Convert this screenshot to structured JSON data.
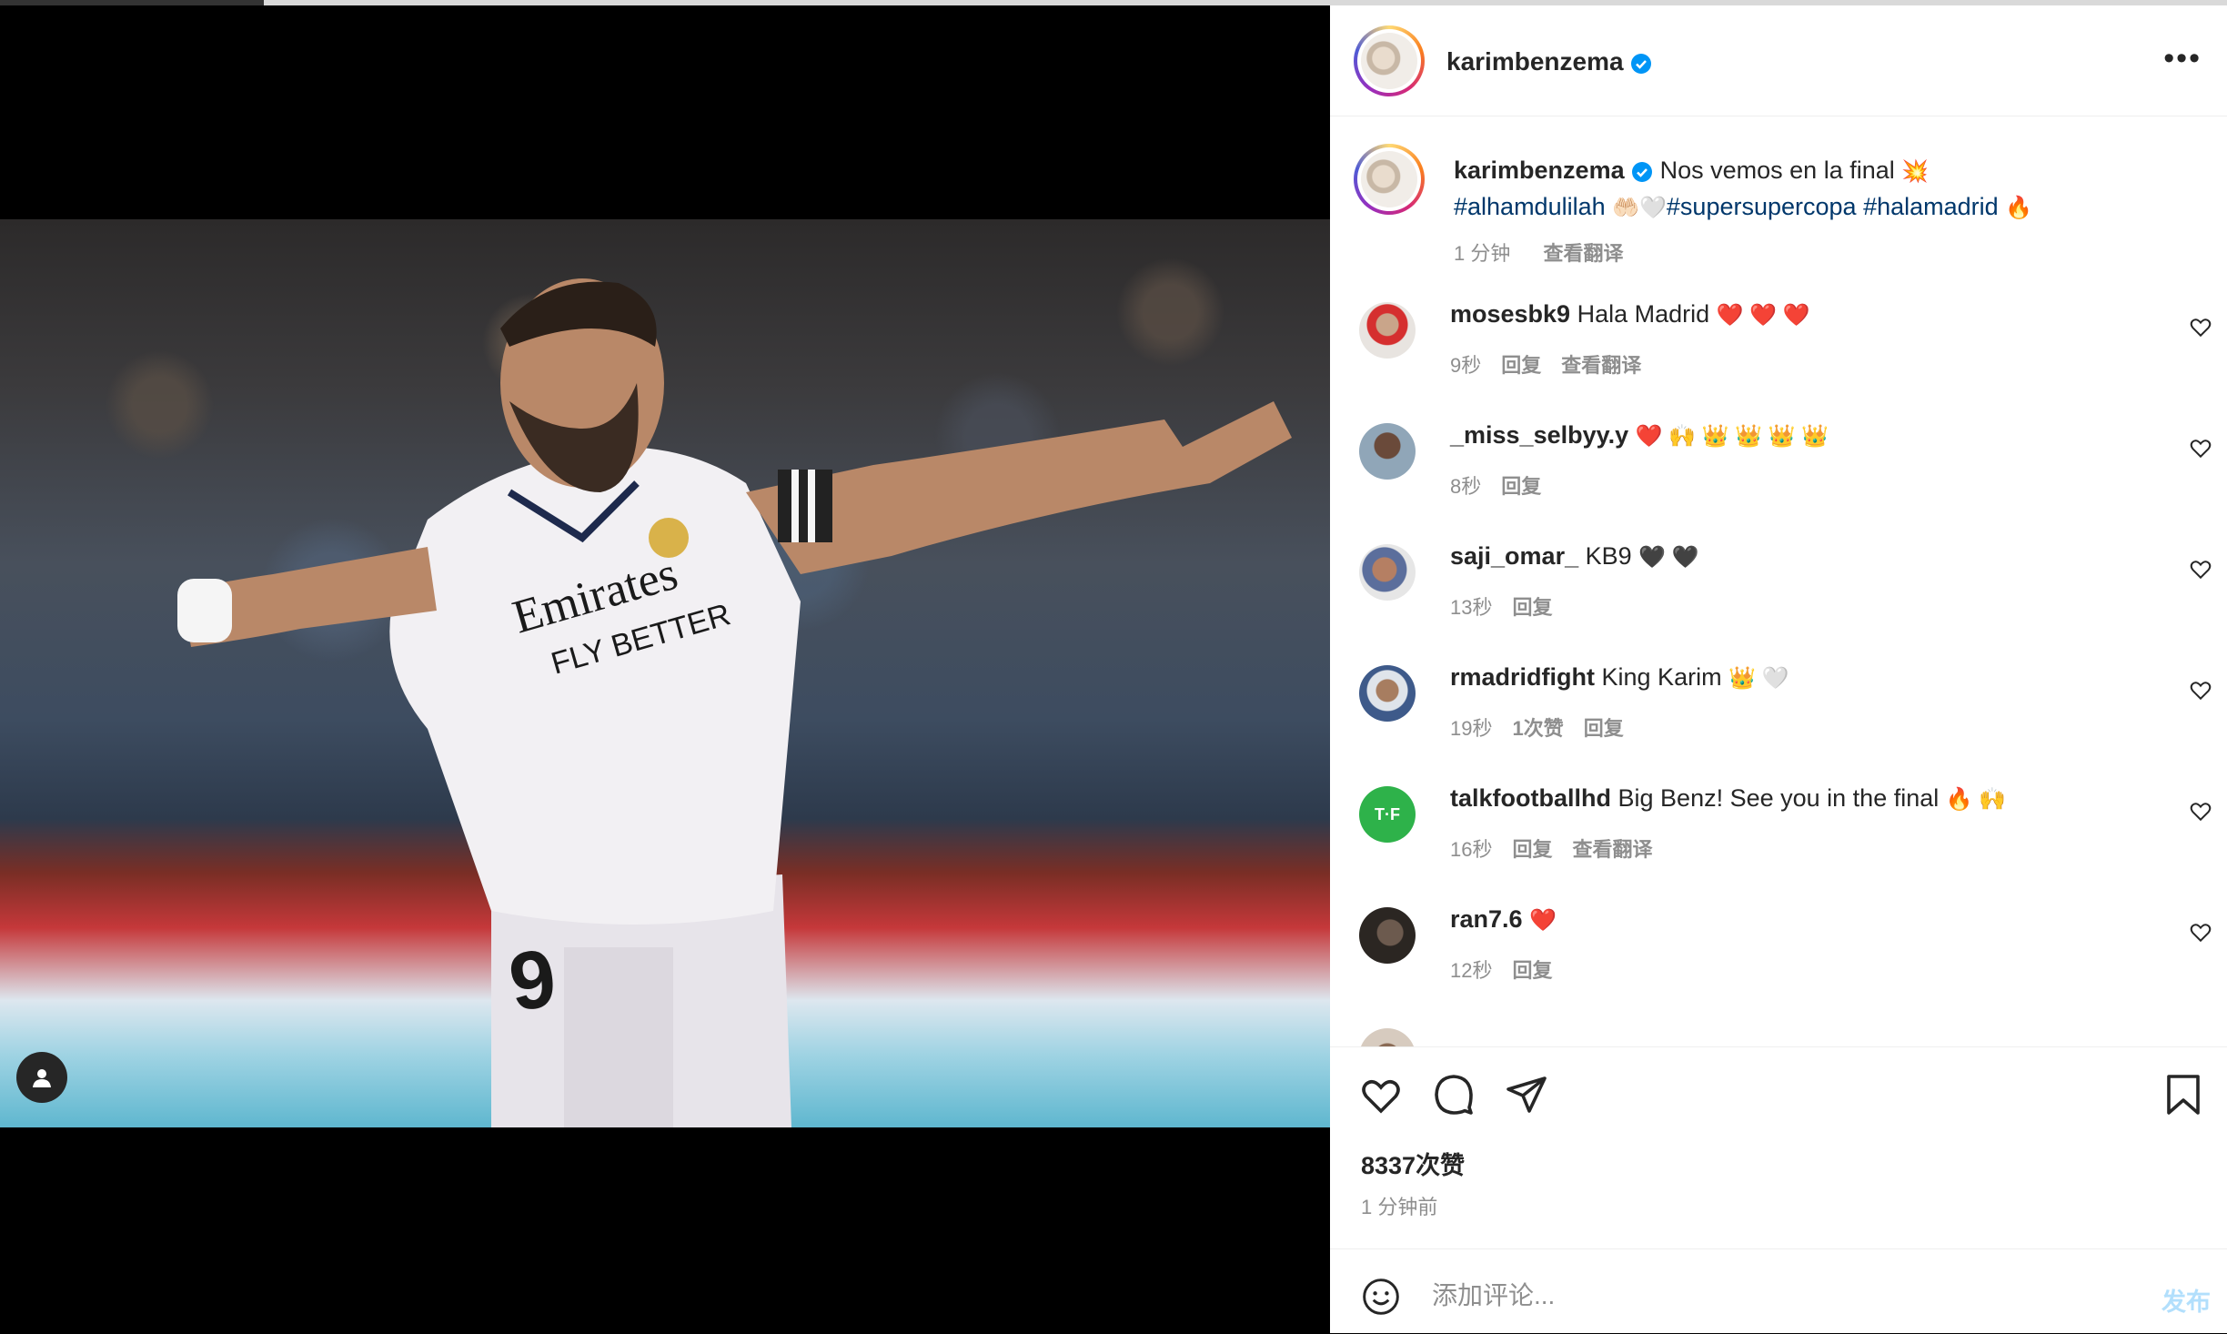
{
  "post": {
    "username": "karimbenzema",
    "caption_text": "Nos vemos en la final",
    "caption_emoji_1": "💥",
    "hashtag_1": "#alhamdulilah",
    "caption_emoji_2": "🤲🏻🤍",
    "hashtag_2": "#supersupercopa",
    "hashtag_3": "#halamadrid",
    "caption_emoji_3": "🔥",
    "time": "1 分钟",
    "translate": "查看翻译",
    "likes": "8337次赞",
    "timestamp": "1 分钟前"
  },
  "comments": [
    {
      "user": "mosesbk9",
      "text": "Hala Madrid",
      "emoji": "❤️ ❤️ ❤️",
      "time": "9秒",
      "reply": "回复",
      "translate": "查看翻译"
    },
    {
      "user": "_miss_selbyy.y",
      "text": "",
      "emoji": "❤️ 🙌 👑 👑 👑 👑",
      "time": "8秒",
      "reply": "回复"
    },
    {
      "user": "saji_omar_",
      "text": "KB9",
      "emoji": "🖤 🖤",
      "time": "13秒",
      "reply": "回复"
    },
    {
      "user": "rmadridfight",
      "text": "King Karim",
      "emoji": "👑 🤍",
      "time": "19秒",
      "likes": "1次赞",
      "reply": "回复"
    },
    {
      "user": "talkfootballhd",
      "text": "Big Benz! See you in the final",
      "emoji": "🔥 🙌",
      "time": "16秒",
      "reply": "回复",
      "translate": "查看翻译"
    },
    {
      "user": "ran7.6",
      "text": "",
      "emoji": "❤️",
      "time": "12秒",
      "reply": "回复"
    }
  ],
  "add_comment": {
    "placeholder": "添加评论...",
    "post_label": "发布"
  },
  "icons": {
    "like": "heart-icon",
    "comment": "comment-icon",
    "share": "send-icon",
    "save": "bookmark-icon",
    "more": "more-icon",
    "emoji": "smile-icon",
    "verified": "verified-badge-icon",
    "user": "user-icon"
  },
  "colors": {
    "hashtag": "#00376b",
    "verified": "#0095f6",
    "post_disabled": "#b2dffc",
    "secondary": "#8e8e8e"
  }
}
